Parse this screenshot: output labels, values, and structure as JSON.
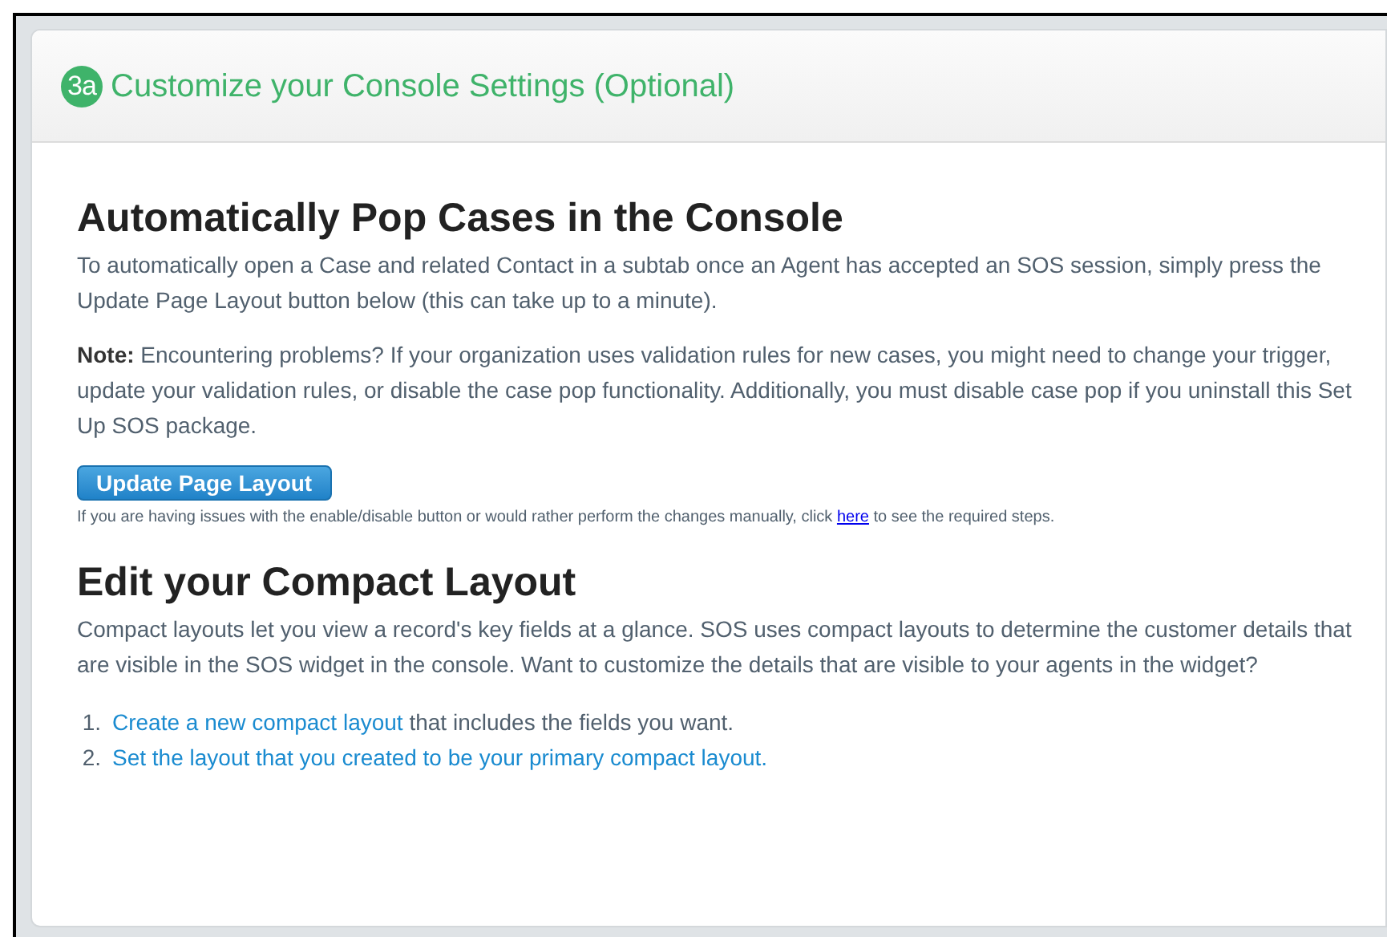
{
  "header": {
    "step_badge": "3a",
    "title": "Customize your Console Settings (Optional)"
  },
  "sections": [
    {
      "heading": "Automatically Pop Cases in the Console",
      "paragraphs": [
        "To automatically open a Case and related Contact in a subtab once an Agent has accepted an SOS session, simply press the Update Page Layout button below (this can take up to a minute).",
        "**Note:** Encountering problems? If your organization uses validation rules for new cases, you might need to change your trigger, update your validation rules, or disable the case pop functionality. Additionally, you must disable case pop if you uninstall this Set Up SOS package."
      ],
      "button": "Update Page Layout",
      "help": {
        "before": "If you are having issues with the enable/disable button or would rather perform the changes manually, click",
        "link": "here",
        "after": "to see the required steps."
      }
    },
    {
      "heading": "Edit your Compact Layout",
      "paragraphs": [
        "Compact layouts let you view a record's key fields at a glance. SOS uses compact layouts to determine the customer details that are visible in the SOS widget in the console. Want to customize the details that are visible to your agents in the widget?"
      ],
      "steps": [
        {
          "number": "1.",
          "link": "Create a new compact layout",
          "text": "that includes the fields you want."
        },
        {
          "number": "2.",
          "link": "Set the layout that you created to be your primary compact layout."
        }
      ]
    }
  ]
}
